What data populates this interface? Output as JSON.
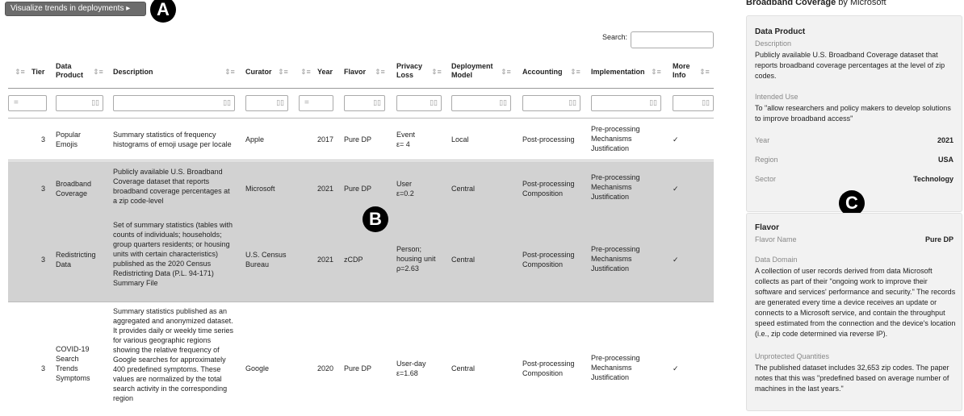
{
  "viz_button": {
    "label": "Visualize trends in deployments ▸"
  },
  "badges": {
    "a": "A",
    "b": "B",
    "c": "C"
  },
  "search": {
    "label": "Search:",
    "value": ""
  },
  "table": {
    "headers": {
      "tier": "Tier",
      "data_product": "Data Product",
      "description": "Description",
      "curator": "Curator",
      "year": "Year",
      "flavor": "Flavor",
      "privacy_loss": "Privacy Loss",
      "deployment_model": "Deployment Model",
      "accounting": "Accounting",
      "implementation": "Implementation",
      "more_info": "More Info"
    },
    "sort_glyph": "⇕≡",
    "filter_icon": "▯▯",
    "filter_eq": "=",
    "rows": [
      {
        "tier": "3",
        "data_product": "Popular Emojis",
        "description": "Summary statistics of frequency histograms of emoji usage per locale",
        "curator": "Apple",
        "year": "2017",
        "flavor": "Pure DP",
        "privacy_loss": "Event\nε= 4",
        "deployment_model": "Local",
        "accounting": "Post-processing",
        "implementation": "Pre-processing\nMechanisms\nJustification",
        "more_info": "✓"
      },
      {
        "tier": "3",
        "data_product": "Broadband Coverage",
        "description": "Publicly available U.S. Broadband Coverage dataset that reports broadband coverage percentages at a zip code-level",
        "curator": "Microsoft",
        "year": "2021",
        "flavor": "Pure DP",
        "privacy_loss": "User\nε=0.2",
        "deployment_model": "Central",
        "accounting": "Post-processing\nComposition",
        "implementation": "Pre-processing\nMechanisms\nJustification",
        "more_info": "✓"
      },
      {
        "tier": "3",
        "data_product": "Redistricting Data",
        "description": "Set of summary statistics (tables with counts of individuals; households; group quarters residents; or housing units with certain characteristics) published as the 2020 Census Redistricting Data (P.L. 94-171) Summary File",
        "curator": "U.S. Census Bureau",
        "year": "2021",
        "flavor": "zCDP",
        "privacy_loss": "Person;\nhousing unit\nρ=2.63",
        "deployment_model": "Central",
        "accounting": "Post-processing\nComposition",
        "implementation": "Pre-processing\nMechanisms\nJustification",
        "more_info": "✓"
      },
      {
        "tier": "3",
        "data_product": "COVID-19 Search Trends Symptoms",
        "description": "Summary statistics published as an aggregated and anonymized dataset. It provides daily or weekly time series for various geographic regions showing the relative frequency of Google searches for approximately 400 predefined symptoms. These values are normalized by the total search activity in the corresponding region",
        "curator": "Google",
        "year": "2020",
        "flavor": "Pure DP",
        "privacy_loss": "User-day\nε=1.68",
        "deployment_model": "Central",
        "accounting": "Post-processing\nComposition",
        "implementation": "Pre-processing\nMechanisms\nJustification",
        "more_info": "✓"
      }
    ]
  },
  "panel": {
    "title_bold": "Broadband Coverage",
    "title_rest": " by Microsoft",
    "data_product": {
      "heading": "Data Product",
      "description_label": "Description",
      "description": "Publicly available U.S. Broadband Coverage dataset that reports broadband coverage percentages at the level of zip codes.",
      "intended_use_label": "Intended Use",
      "intended_use": "To \"allow researchers and policy makers to develop solutions to improve broadband access\"",
      "year_label": "Year",
      "year": "2021",
      "region_label": "Region",
      "region": "USA",
      "sector_label": "Sector",
      "sector": "Technology"
    },
    "flavor": {
      "heading": "Flavor",
      "flavor_name_label": "Flavor Name",
      "flavor_name": "Pure DP",
      "data_domain_label": "Data Domain",
      "data_domain": "A collection of user records derived from data Microsoft collects as part of their \"ongoing work to improve their software and services' performance and security.\" The records are generated every time a device receives an update or connects to a Microsoft service, and contain the throughput speed estimated from the connection and the device's location (i.e., zip code determined via reverse IP).",
      "unprotected_label": "Unprotected Quantities",
      "unprotected": "The published dataset includes 32,653 zip codes. The paper notes that this was \"predefined based on average number of machines in the last years.\""
    }
  }
}
